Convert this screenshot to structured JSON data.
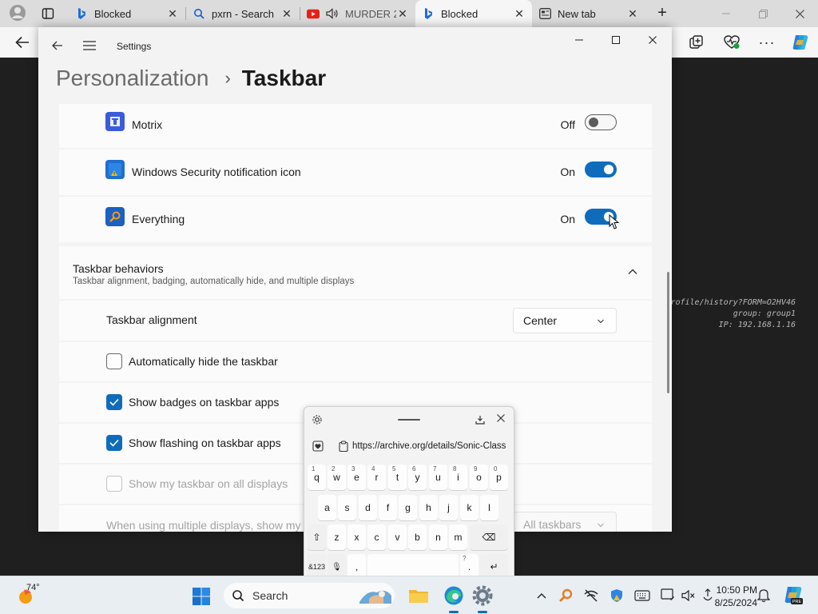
{
  "browser": {
    "tabs": [
      {
        "label": "Blocked",
        "icon": "bing-icon"
      },
      {
        "label": "pxrn - Search",
        "icon": "search-icon"
      },
      {
        "label": "MURDER 2",
        "icon": "youtube-icon"
      },
      {
        "label": "Blocked",
        "icon": "bing-icon"
      },
      {
        "label": "New tab",
        "icon": "newtab-icon"
      }
    ],
    "new_tab_symbol": "+",
    "close_symbol": "✕"
  },
  "overlay": {
    "line1": "profile/history?FORM=O2HV46",
    "line2": "group: group1",
    "line3": "IP: 192.168.1.16"
  },
  "settings": {
    "app_title": "Settings",
    "breadcrumb_parent": "Personalization",
    "breadcrumb_separator": "›",
    "breadcrumb_current": "Taskbar",
    "tray_items": [
      {
        "name": "Motrix",
        "state": "Off",
        "enabled": false,
        "icon_color": "#3b5bdb"
      },
      {
        "name": "Windows Security notification icon",
        "state": "On",
        "enabled": true,
        "icon_color": "#1f6fd1"
      },
      {
        "name": "Everything",
        "state": "On",
        "enabled": true,
        "icon_color": "#1d5fc4"
      }
    ],
    "behaviors": {
      "title": "Taskbar behaviors",
      "subtitle": "Taskbar alignment, badging, automatically hide, and multiple displays",
      "alignment_label": "Taskbar alignment",
      "alignment_value": "Center",
      "options": [
        {
          "label": "Automatically hide the taskbar",
          "checked": false,
          "disabled": false
        },
        {
          "label": "Show badges on taskbar apps",
          "checked": true,
          "disabled": false
        },
        {
          "label": "Show flashing on taskbar apps",
          "checked": true,
          "disabled": false
        },
        {
          "label": "Show my taskbar on all displays",
          "checked": false,
          "disabled": true
        }
      ],
      "multi_display_label": "When using multiple displays, show my",
      "multi_display_value": "All taskbars"
    }
  },
  "keyboard": {
    "clipboard_url": "https://archive.org/details/Sonic-Class",
    "row1": [
      {
        "k": "q",
        "n": "1"
      },
      {
        "k": "w",
        "n": "2"
      },
      {
        "k": "e",
        "n": "3"
      },
      {
        "k": "r",
        "n": "4"
      },
      {
        "k": "t",
        "n": "5"
      },
      {
        "k": "y",
        "n": "6"
      },
      {
        "k": "u",
        "n": "7"
      },
      {
        "k": "i",
        "n": "8"
      },
      {
        "k": "o",
        "n": "9"
      },
      {
        "k": "p",
        "n": "0"
      }
    ],
    "row2": [
      "a",
      "s",
      "d",
      "f",
      "g",
      "h",
      "j",
      "k",
      "l"
    ],
    "row3": [
      "z",
      "x",
      "c",
      "v",
      "b",
      "n",
      "m"
    ],
    "shift_key": "⇧",
    "backspace_key": "⌫",
    "symbols_key": "&123",
    "mic_key": "🎙",
    "comma_key": ",",
    "period_key": ".",
    "period_alt": "?",
    "enter_key": "↵"
  },
  "taskbar": {
    "temperature": "74°",
    "search_label": "Search",
    "time": "10:50 PM",
    "date": "8/25/2024"
  },
  "colors": {
    "accent": "#0f6cbd",
    "settings_bg": "#f3f3f3",
    "card_bg": "#fbfbfb"
  }
}
